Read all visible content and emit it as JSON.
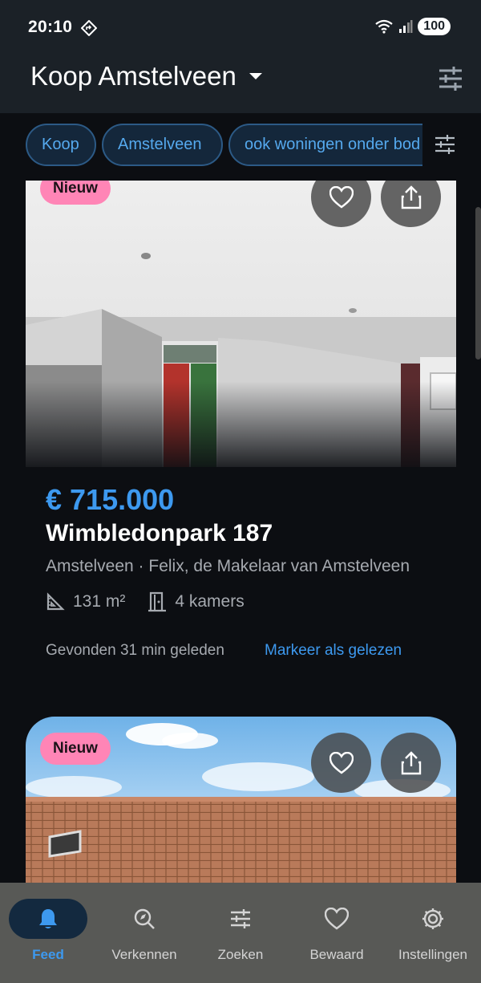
{
  "status_bar": {
    "time": "20:10",
    "battery": "100"
  },
  "app_bar": {
    "title": "Koop Amstelveen"
  },
  "chips": [
    {
      "label": "Koop"
    },
    {
      "label": "Amstelveen"
    },
    {
      "label": "ook woningen onder bod"
    }
  ],
  "listings": [
    {
      "badge": "Nieuw",
      "price": "€ 715.000",
      "address": "Wimbledonpark 187",
      "meta": "Amstelveen · Felix, de Makelaar van Amstelveen",
      "area": "131 m²",
      "rooms": "4 kamers",
      "found": "Gevonden 31 min geleden",
      "mark_read": "Markeer als gelezen"
    },
    {
      "badge": "Nieuw"
    }
  ],
  "bottom_nav": [
    {
      "label": "Feed",
      "icon": "bell-icon",
      "active": true
    },
    {
      "label": "Verkennen",
      "icon": "explore-icon",
      "active": false
    },
    {
      "label": "Zoeken",
      "icon": "tune-icon",
      "active": false
    },
    {
      "label": "Bewaard",
      "icon": "heart-icon",
      "active": false
    },
    {
      "label": "Instellingen",
      "icon": "gear-icon",
      "active": false
    }
  ],
  "colors": {
    "accent": "#3d99ef",
    "badge": "#ff85b6",
    "app_bar": "#1b2127",
    "background": "#0c0e12"
  }
}
